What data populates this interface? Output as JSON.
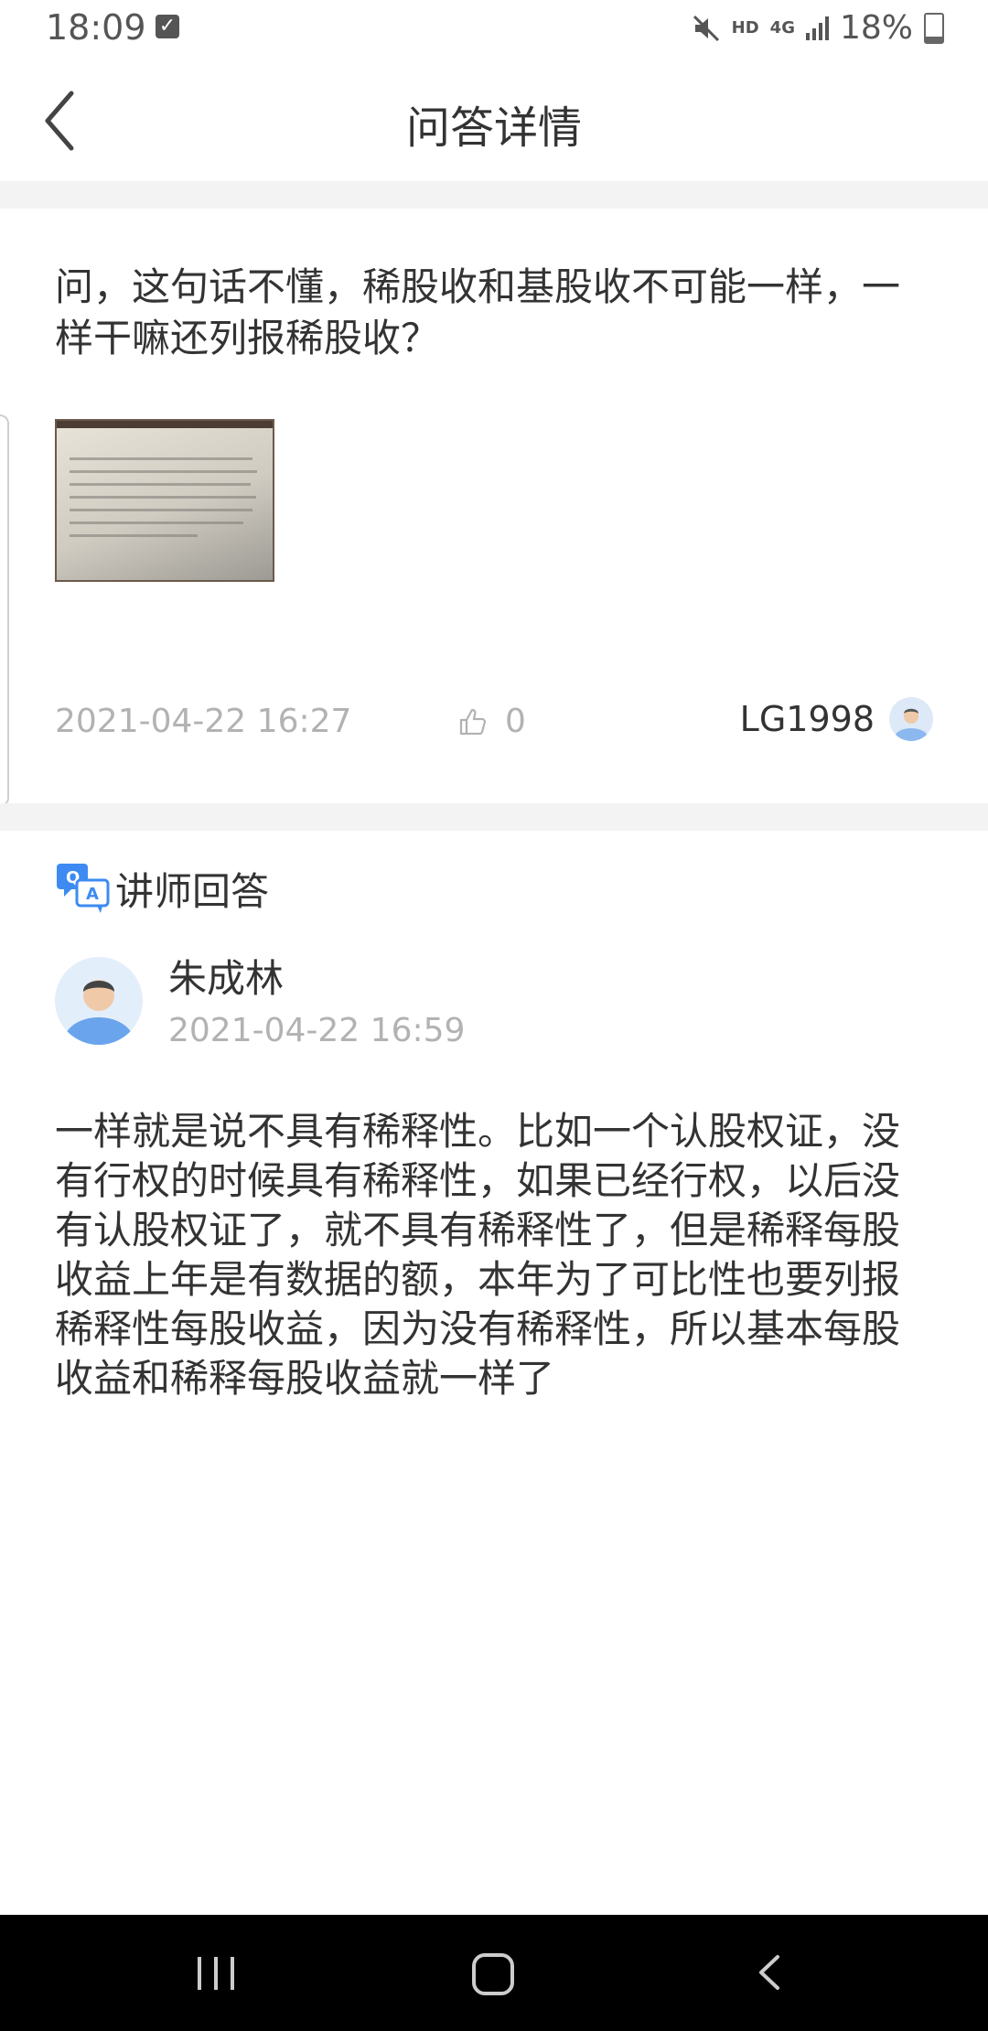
{
  "status_bar": {
    "time": "18:09",
    "hd_label": "HD",
    "network_label": "4G",
    "battery": "18%"
  },
  "header": {
    "title": "问答详情"
  },
  "question": {
    "text": "问，这句话不懂，稀股收和基股收不可能一样，一样干嘛还列报稀股收？",
    "date": "2021-04-22 16:27",
    "like_count": "0",
    "author": "LG1998"
  },
  "answer_section": {
    "title": "讲师回答",
    "teacher_name": "朱成林",
    "date": "2021-04-22 16:59",
    "text": "一样就是说不具有稀释性。比如一个认股权证，没有行权的时候具有稀释性，如果已经行权，以后没有认股权证了，就不具有稀释性了，但是稀释每股收益上年是有数据的额，本年为了可比性也要列报稀释性每股收益，因为没有稀释性，所以基本每股收益和稀释每股收益就一样了"
  },
  "colors": {
    "accent": "#3d8bf2",
    "muted_text": "#b2b2b2",
    "primary_text": "#333333",
    "divider": "#f3f3f3"
  }
}
